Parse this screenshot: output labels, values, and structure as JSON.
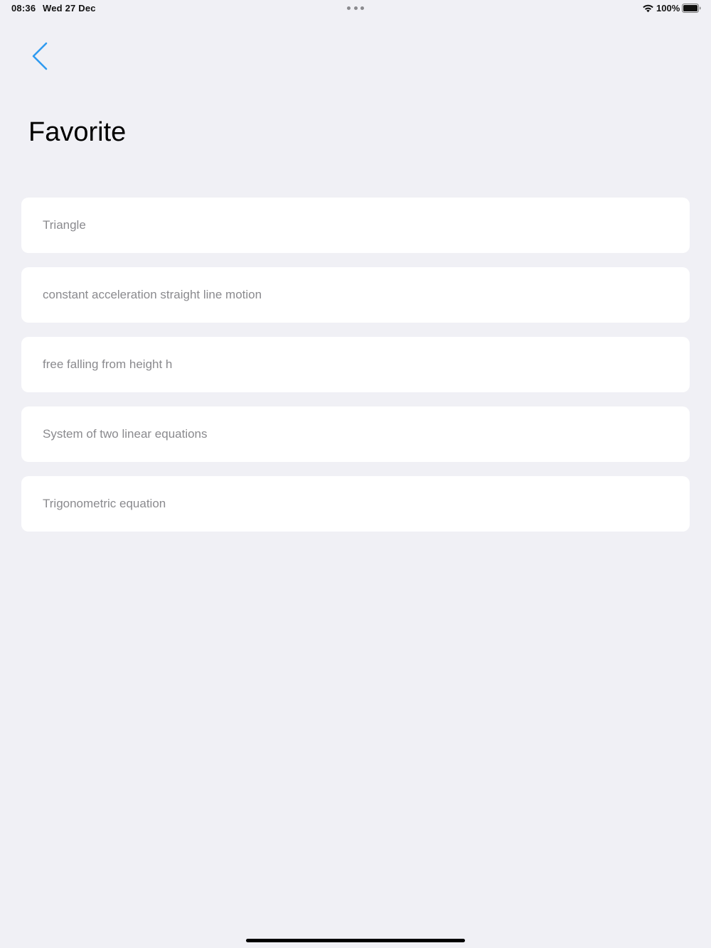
{
  "status_bar": {
    "time": "08:36",
    "date": "Wed 27 Dec",
    "battery_percent": "100%",
    "wifi_icon": "wifi-icon",
    "battery_icon": "battery-full-icon"
  },
  "nav": {
    "back_icon": "chevron-left-icon",
    "accent_color": "#2F9BF0"
  },
  "header": {
    "title": "Favorite"
  },
  "favorites": {
    "items": [
      {
        "label": "Triangle"
      },
      {
        "label": "constant acceleration straight line motion"
      },
      {
        "label": "free falling from height h"
      },
      {
        "label": "System of two linear equations"
      },
      {
        "label": "Trigonometric equation"
      }
    ]
  },
  "colors": {
    "background": "#F0F0F5",
    "card": "#FFFFFF",
    "item_text": "#8A8A8E",
    "title_text": "#000000"
  }
}
